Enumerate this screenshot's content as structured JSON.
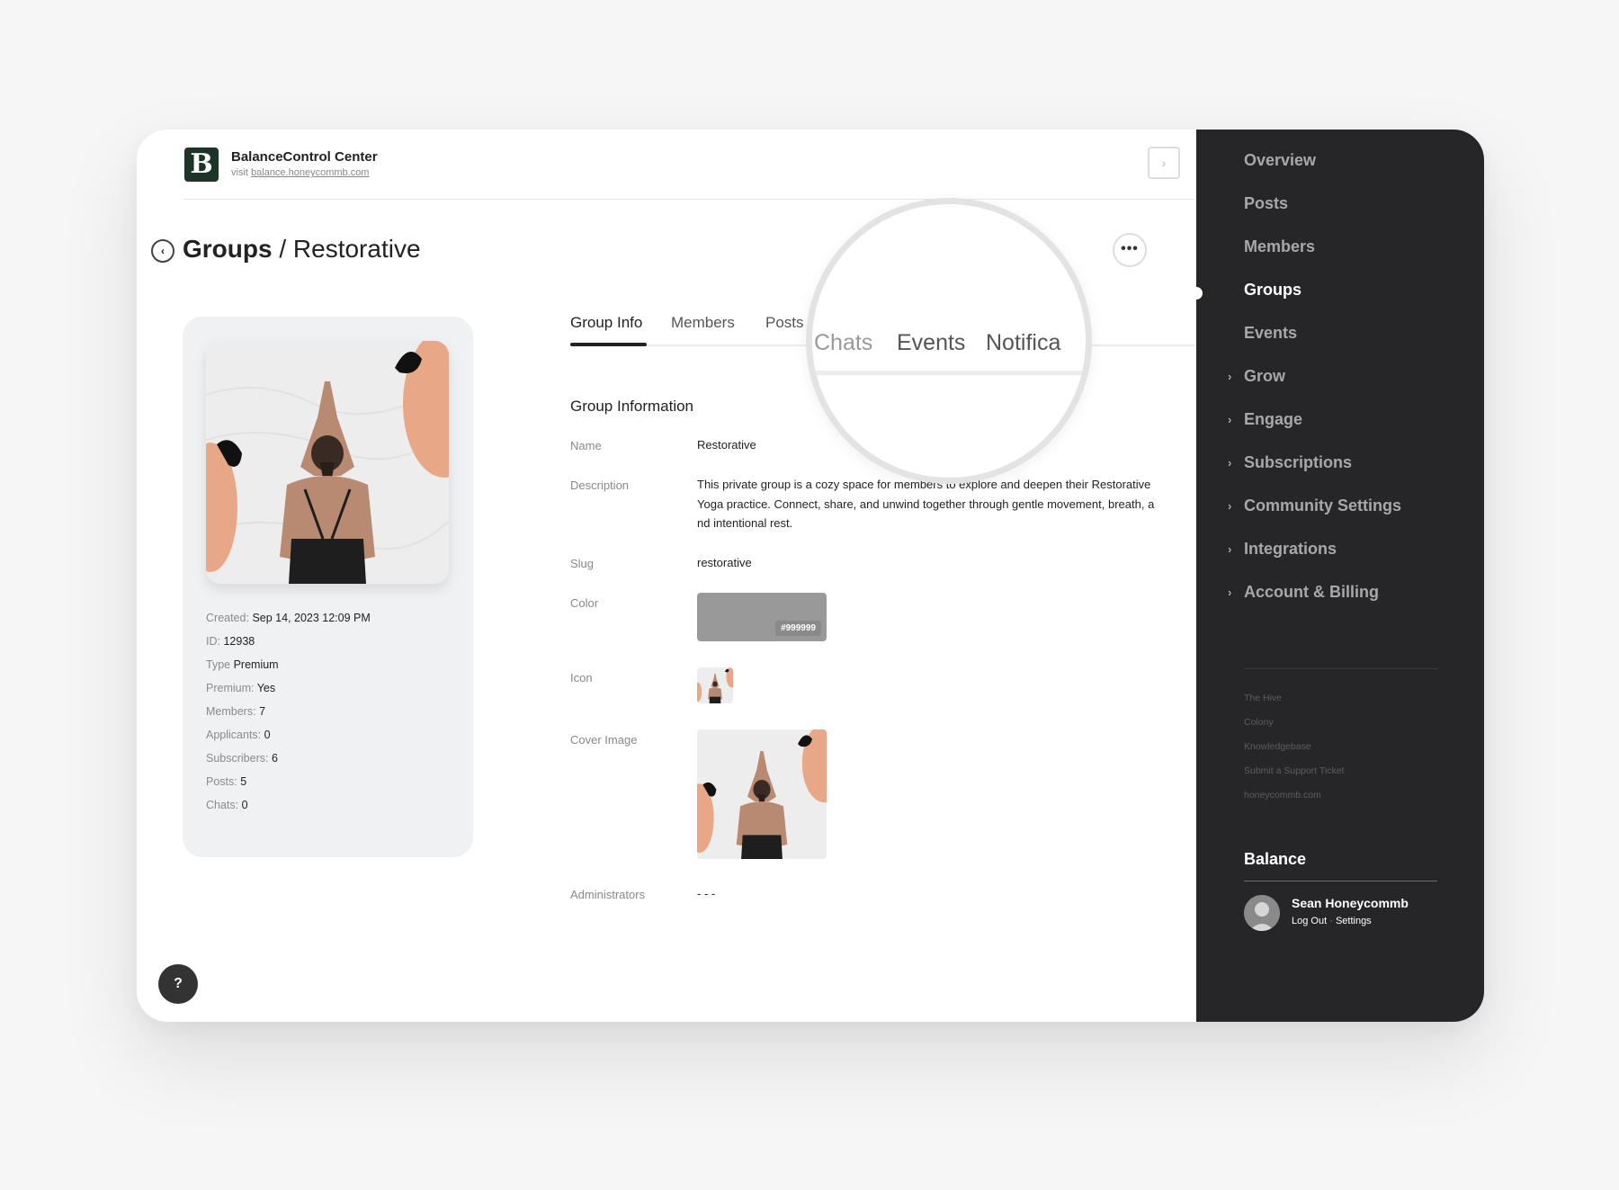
{
  "brand": {
    "logo_letter": "B",
    "title": "BalanceControl Center",
    "visit_prefix": "visit",
    "visit_link": "balance.honeycommb.com"
  },
  "page": {
    "section": "Groups",
    "separator": "/",
    "title": "Restorative"
  },
  "meta": [
    {
      "label": "Created:",
      "value": "Sep 14, 2023 12:09 PM"
    },
    {
      "label": "ID:",
      "value": "12938"
    },
    {
      "label": "Type",
      "value": "Premium"
    },
    {
      "label": "Premium:",
      "value": "Yes"
    },
    {
      "label": "Members:",
      "value": "7"
    },
    {
      "label": "Applicants:",
      "value": "0"
    },
    {
      "label": "Subscribers:",
      "value": "6"
    },
    {
      "label": "Posts:",
      "value": "5"
    },
    {
      "label": "Chats:",
      "value": "0"
    }
  ],
  "tabs": [
    "Group Info",
    "Members",
    "Posts"
  ],
  "magnifier_tabs": [
    "Chats",
    "Events",
    "Notifica"
  ],
  "info": {
    "section_title": "Group Information",
    "name_label": "Name",
    "name_value": "Restorative",
    "description_label": "Description",
    "description_value": "This private group is a cozy space for members to explore and deepen their Restorative Yoga practice. Connect, share, and unwind together through gentle movement, breath, and intentional rest.",
    "slug_label": "Slug",
    "slug_value": "restorative",
    "color_label": "Color",
    "color_value": "#999999",
    "icon_label": "Icon",
    "cover_label": "Cover Image",
    "admins_label": "Administrators",
    "admins_value": "- - -"
  },
  "help_icon": "?",
  "sidebar": {
    "items": [
      {
        "label": "Overview",
        "expandable": false
      },
      {
        "label": "Posts",
        "expandable": false
      },
      {
        "label": "Members",
        "expandable": false
      },
      {
        "label": "Groups",
        "expandable": false,
        "active": true
      },
      {
        "label": "Events",
        "expandable": false
      },
      {
        "label": "Grow",
        "expandable": true
      },
      {
        "label": "Engage",
        "expandable": true
      },
      {
        "label": "Subscriptions",
        "expandable": true
      },
      {
        "label": "Community Settings",
        "expandable": true
      },
      {
        "label": "Integrations",
        "expandable": true
      },
      {
        "label": "Account & Billing",
        "expandable": true
      }
    ],
    "links": [
      "The Hive",
      "Colony",
      "Knowledgebase",
      "Submit a Support Ticket",
      "honeycommb.com"
    ],
    "org_name": "Balance",
    "user": {
      "name": "Sean Honeycommb",
      "logout": "Log Out",
      "dot": "·",
      "settings": "Settings"
    }
  },
  "colors": {
    "sidebar_bg": "#262628",
    "logo_bg": "#1d3527",
    "accent_peach": "#e8a888"
  }
}
